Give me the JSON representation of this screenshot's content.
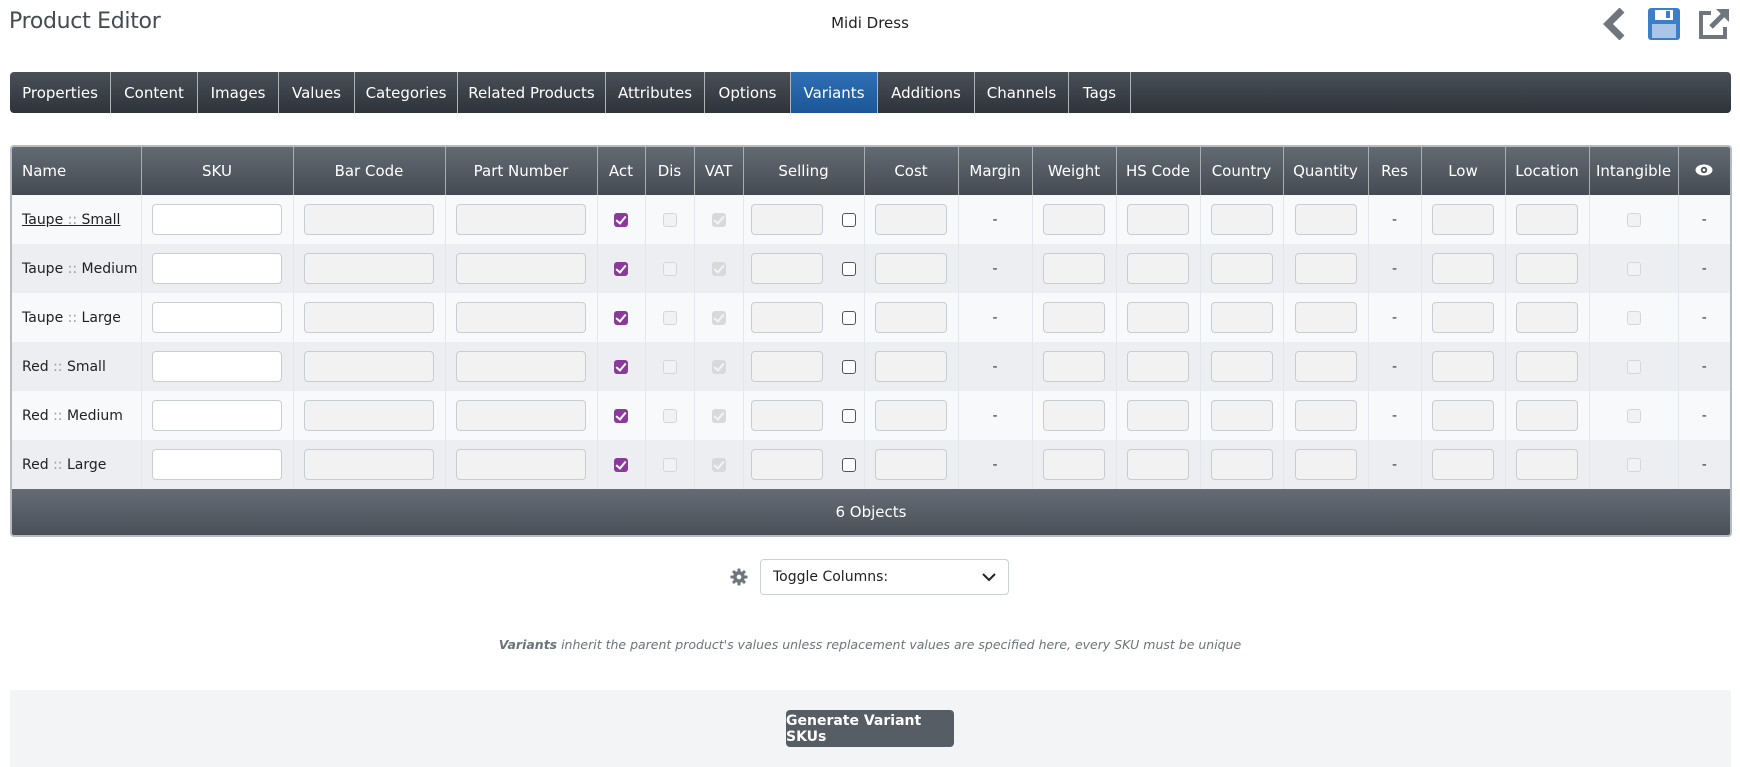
{
  "header": {
    "title": "Product Editor",
    "product_name": "Midi Dress",
    "icons": [
      "back-chevron-icon",
      "save-icon",
      "external-link-icon"
    ]
  },
  "tabs": [
    {
      "label": "Properties",
      "active": false
    },
    {
      "label": "Content",
      "active": false
    },
    {
      "label": "Images",
      "active": false
    },
    {
      "label": "Values",
      "active": false
    },
    {
      "label": "Categories",
      "active": false
    },
    {
      "label": "Related Products",
      "active": false
    },
    {
      "label": "Attributes",
      "active": false
    },
    {
      "label": "Options",
      "active": false
    },
    {
      "label": "Variants",
      "active": true
    },
    {
      "label": "Additions",
      "active": false
    },
    {
      "label": "Channels",
      "active": false
    },
    {
      "label": "Tags",
      "active": false
    }
  ],
  "table": {
    "columns": [
      "Name",
      "SKU",
      "Bar Code",
      "Part Number",
      "Act",
      "Dis",
      "VAT",
      "Selling",
      "Cost",
      "Margin",
      "Weight",
      "HS Code",
      "Country",
      "Quantity",
      "Res",
      "Low",
      "Location",
      "Intangible",
      "eye-icon"
    ],
    "rows": [
      {
        "color": "Taupe",
        "size": "Small",
        "linked": true,
        "sku": "",
        "bar_code": "",
        "part_number": "",
        "act": true,
        "dis": false,
        "vat": true,
        "selling": "",
        "selling_override": false,
        "cost": "",
        "margin": "-",
        "weight": "",
        "hs_code": "",
        "country": "",
        "quantity": "",
        "res": "-",
        "low": "",
        "location": "",
        "intangible": false,
        "visible": "-"
      },
      {
        "color": "Taupe",
        "size": "Medium",
        "linked": false,
        "sku": "",
        "bar_code": "",
        "part_number": "",
        "act": true,
        "dis": false,
        "vat": true,
        "selling": "",
        "selling_override": false,
        "cost": "",
        "margin": "-",
        "weight": "",
        "hs_code": "",
        "country": "",
        "quantity": "",
        "res": "-",
        "low": "",
        "location": "",
        "intangible": false,
        "visible": "-"
      },
      {
        "color": "Taupe",
        "size": "Large",
        "linked": false,
        "sku": "",
        "bar_code": "",
        "part_number": "",
        "act": true,
        "dis": false,
        "vat": true,
        "selling": "",
        "selling_override": false,
        "cost": "",
        "margin": "-",
        "weight": "",
        "hs_code": "",
        "country": "",
        "quantity": "",
        "res": "-",
        "low": "",
        "location": "",
        "intangible": false,
        "visible": "-"
      },
      {
        "color": "Red",
        "size": "Small",
        "linked": false,
        "sku": "",
        "bar_code": "",
        "part_number": "",
        "act": true,
        "dis": false,
        "vat": true,
        "selling": "",
        "selling_override": false,
        "cost": "",
        "margin": "-",
        "weight": "",
        "hs_code": "",
        "country": "",
        "quantity": "",
        "res": "-",
        "low": "",
        "location": "",
        "intangible": false,
        "visible": "-"
      },
      {
        "color": "Red",
        "size": "Medium",
        "linked": false,
        "sku": "",
        "bar_code": "",
        "part_number": "",
        "act": true,
        "dis": false,
        "vat": true,
        "selling": "",
        "selling_override": false,
        "cost": "",
        "margin": "-",
        "weight": "",
        "hs_code": "",
        "country": "",
        "quantity": "",
        "res": "-",
        "low": "",
        "location": "",
        "intangible": false,
        "visible": "-"
      },
      {
        "color": "Red",
        "size": "Large",
        "linked": false,
        "sku": "",
        "bar_code": "",
        "part_number": "",
        "act": true,
        "dis": false,
        "vat": true,
        "selling": "",
        "selling_override": false,
        "cost": "",
        "margin": "-",
        "weight": "",
        "hs_code": "",
        "country": "",
        "quantity": "",
        "res": "-",
        "low": "",
        "location": "",
        "intangible": false,
        "visible": "-"
      }
    ],
    "name_separator": "::",
    "footer": "6 Objects"
  },
  "toggle_columns": {
    "icon": "gear-icon",
    "label": "Toggle Columns:"
  },
  "note": {
    "bold": "Variants",
    "text": " inherit the parent product's values unless replacement values are specified here, every SKU must be unique"
  },
  "generate_button": "Generate Variant SKUs",
  "colors": {
    "active_tab": "#2466a8",
    "act_checkbox": "#8b3a9c",
    "save_icon": "#3b7fcb"
  }
}
